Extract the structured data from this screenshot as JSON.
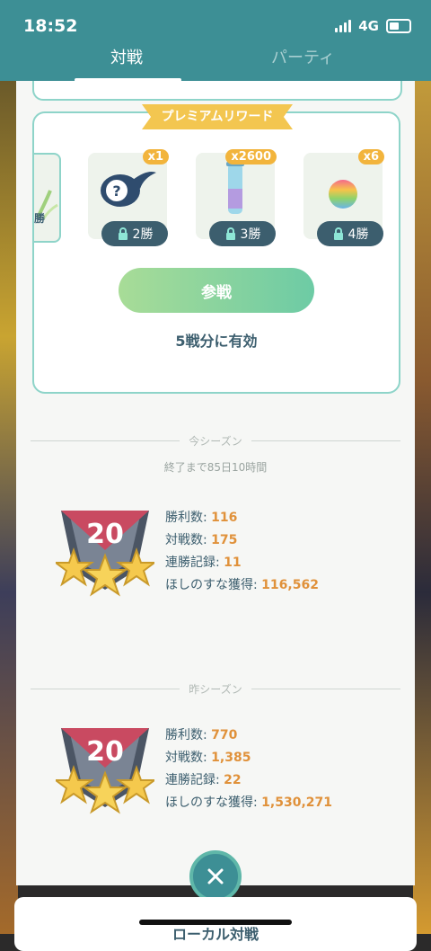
{
  "status_bar": {
    "time": "18:52",
    "network": "4G"
  },
  "tabs": [
    {
      "label": "対戦"
    },
    {
      "label": "パーティ"
    }
  ],
  "premium_reward": {
    "title": "プレミアムリワード",
    "partial_item_label": "勝",
    "items": [
      {
        "icon": "mystery-box-icon",
        "quantity": "x1",
        "wins": "2勝"
      },
      {
        "icon": "incense-stardust-icon",
        "quantity": "x2600",
        "wins": "3勝"
      },
      {
        "icon": "rare-candy-icon",
        "quantity": "x6",
        "wins": "4勝"
      }
    ],
    "join_button": "参戦",
    "valid_text": "5戦分に有効"
  },
  "current_season": {
    "header": "今シーズン",
    "ends_in": "終了まで85日10時間",
    "rank": "20",
    "stats": [
      {
        "label": "勝利数: ",
        "value": "116"
      },
      {
        "label": "対戦数: ",
        "value": "175"
      },
      {
        "label": "連勝記録: ",
        "value": "11"
      },
      {
        "label": "ほしのすな獲得: ",
        "value": "116,562"
      }
    ]
  },
  "previous_season": {
    "header": "昨シーズン",
    "rank": "20",
    "stats": [
      {
        "label": "勝利数: ",
        "value": "770"
      },
      {
        "label": "対戦数: ",
        "value": "1,385"
      },
      {
        "label": "連勝記録: ",
        "value": "22"
      },
      {
        "label": "ほしのすな獲得: ",
        "value": "1,530,271"
      }
    ]
  },
  "bottom": {
    "label": "ローカル対戦"
  },
  "colors": {
    "teal": "#3d8f95",
    "mint": "#8ed4c9",
    "gold": "#f3c650",
    "stat_value": "#e0913a",
    "text": "#3c5e6e"
  }
}
